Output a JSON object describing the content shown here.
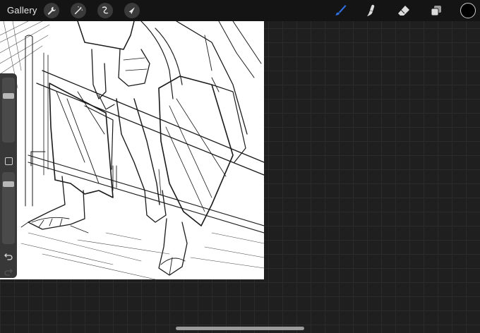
{
  "topbar": {
    "gallery_label": "Gallery",
    "left_tools": [
      "wrench-icon",
      "magic-wand-icon",
      "selection-icon",
      "transform-arrow-icon"
    ],
    "right_tools": [
      "brush-icon",
      "smudge-icon",
      "eraser-icon",
      "layers-icon"
    ],
    "active_tool": "brush",
    "active_tool_color": "#2f6fe0",
    "current_color": "#000000"
  },
  "sidebar": {
    "brush_size_level": 0.74,
    "opacity_level": 0.86
  },
  "canvas": {
    "background": "#ffffff"
  }
}
